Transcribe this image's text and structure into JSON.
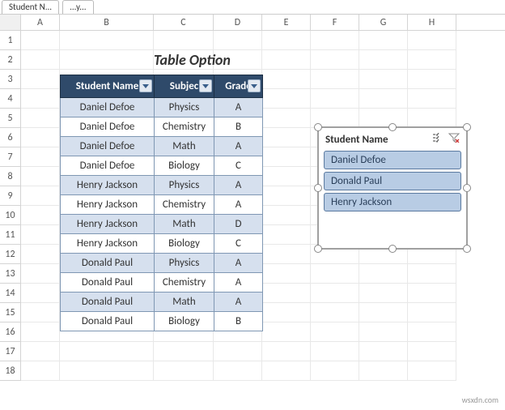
{
  "sheet_tabs": [
    "Student N...",
    "...y..."
  ],
  "columns": [
    "A",
    "B",
    "C",
    "D",
    "E",
    "F",
    "G",
    "H"
  ],
  "row_numbers": [
    1,
    2,
    3,
    4,
    5,
    6,
    7,
    8,
    9,
    10,
    11,
    12,
    13,
    14,
    15,
    16,
    17,
    18
  ],
  "title": "Table Option",
  "table": {
    "headers": {
      "name": "Student Name",
      "subject": "Subjec",
      "grade": "Grade"
    },
    "rows": [
      {
        "name": "Daniel Defoe",
        "subject": "Physics",
        "grade": "A"
      },
      {
        "name": "Daniel Defoe",
        "subject": "Chemistry",
        "grade": "B"
      },
      {
        "name": "Daniel Defoe",
        "subject": "Math",
        "grade": "A"
      },
      {
        "name": "Daniel Defoe",
        "subject": "Biology",
        "grade": "C"
      },
      {
        "name": "Henry Jackson",
        "subject": "Physics",
        "grade": "A"
      },
      {
        "name": "Henry Jackson",
        "subject": "Chemistry",
        "grade": "A"
      },
      {
        "name": "Henry Jackson",
        "subject": "Math",
        "grade": "D"
      },
      {
        "name": "Henry Jackson",
        "subject": "Biology",
        "grade": "C"
      },
      {
        "name": "Donald Paul",
        "subject": "Physics",
        "grade": "A"
      },
      {
        "name": "Donald Paul",
        "subject": "Chemistry",
        "grade": "A"
      },
      {
        "name": "Donald Paul",
        "subject": "Math",
        "grade": "A"
      },
      {
        "name": "Donald Paul",
        "subject": "Biology",
        "grade": "B"
      }
    ]
  },
  "slicer": {
    "title": "Student Name",
    "items": [
      "Daniel Defoe",
      "Donald Paul",
      "Henry Jackson"
    ]
  },
  "watermark": "wsxdn.com"
}
